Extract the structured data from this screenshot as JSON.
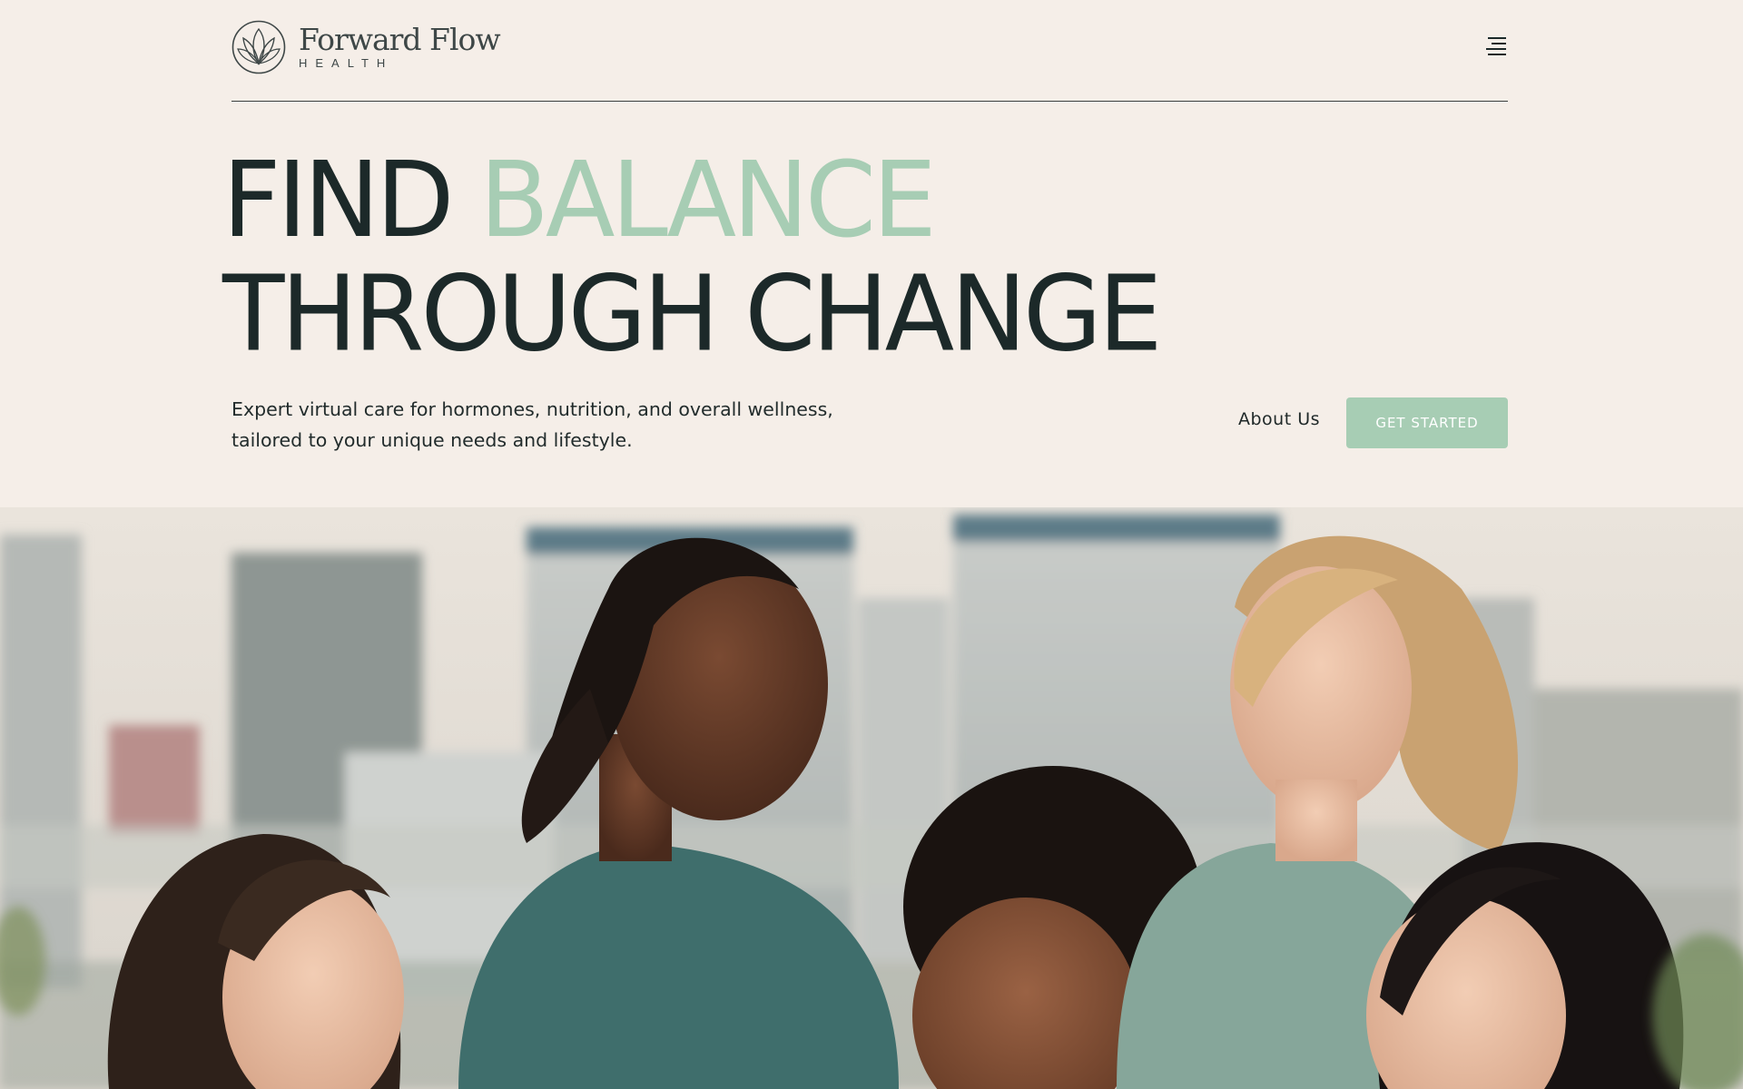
{
  "brand": {
    "name": "Forward Flow",
    "sub": "HEALTH"
  },
  "nav": {
    "menu_icon": "hamburger-menu-icon"
  },
  "hero": {
    "headline_line1_part1": "FIND",
    "headline_line1_accent": "BALANCE",
    "headline_line2": "THROUGH CHANGE",
    "description": "Expert virtual care for hormones, nutrition, and overall wellness, tailored to your unique needs and lifestyle.",
    "about_link": "About Us",
    "cta_label": "GET STARTED"
  },
  "colors": {
    "background": "#f5eee8",
    "accent": "#a7cdb4",
    "text": "#1c2929"
  }
}
